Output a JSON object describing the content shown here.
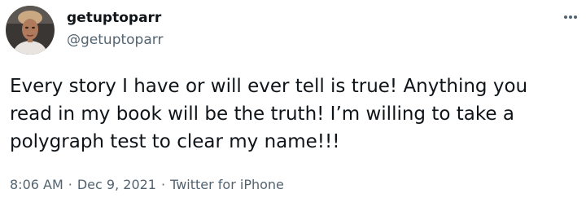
{
  "author": {
    "display_name": "getuptoparr",
    "handle": "@getuptoparr",
    "avatar_icon": "user-avatar-photo"
  },
  "tweet": {
    "text_lines": [
      "Every story I have or will ever tell is true! Anything you",
      "read in my book will be the truth! I’m willing to take a",
      "polygraph test to clear my name!!!"
    ]
  },
  "meta": {
    "time": "8:06 AM",
    "separator": "·",
    "date": "Dec 9, 2021",
    "source": "Twitter for iPhone"
  },
  "icons": {
    "more": "more-options-icon"
  },
  "colors": {
    "text_primary": "#0f1419",
    "text_secondary": "#536471",
    "background": "#ffffff"
  }
}
